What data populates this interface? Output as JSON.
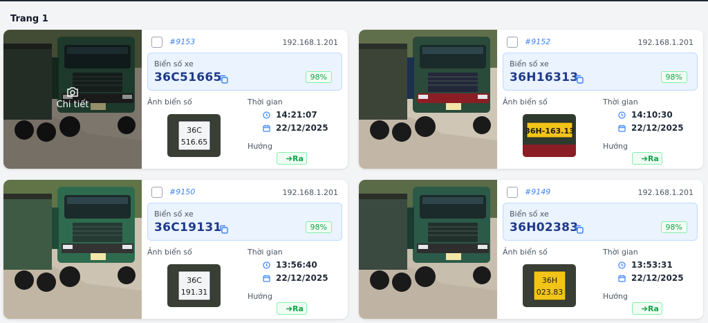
{
  "page": {
    "title": "Trang 1"
  },
  "labels": {
    "plate_caption": "Biển số xe",
    "plate_image": "Ảnh biển số",
    "time": "Thời gian",
    "direction": "Hướng",
    "detail": "Chi tiết"
  },
  "colors": {
    "accent": "#3b82f6",
    "plate_text": "#1e3a8a",
    "confidence_green": "#16a34a",
    "plate_box_bg": "#eaf3fe"
  },
  "records": [
    {
      "id": "#9153",
      "ip": "192.168.1.201",
      "plate": "36C51665",
      "confidence": "98%",
      "time": "14:21:07",
      "date": "22/12/2025",
      "direction": "Ra",
      "crop_line1": "36C",
      "crop_line2": "516.65",
      "crop_style": "white"
    },
    {
      "id": "#9152",
      "ip": "192.168.1.201",
      "plate": "36H16313",
      "confidence": "98%",
      "time": "14:10:30",
      "date": "22/12/2025",
      "direction": "Ra",
      "crop_line1": "36H-163.13",
      "crop_line2": "",
      "crop_style": "yellow-long"
    },
    {
      "id": "#9150",
      "ip": "192.168.1.201",
      "plate": "36C19131",
      "confidence": "98%",
      "time": "13:56:40",
      "date": "22/12/2025",
      "direction": "Ra",
      "crop_line1": "36C",
      "crop_line2": "191.31",
      "crop_style": "white"
    },
    {
      "id": "#9149",
      "ip": "192.168.1.201",
      "plate": "36H02383",
      "confidence": "98%",
      "time": "13:53:31",
      "date": "22/12/2025",
      "direction": "Ra",
      "crop_line1": "36H",
      "crop_line2": "023.83",
      "crop_style": "yellow"
    }
  ]
}
